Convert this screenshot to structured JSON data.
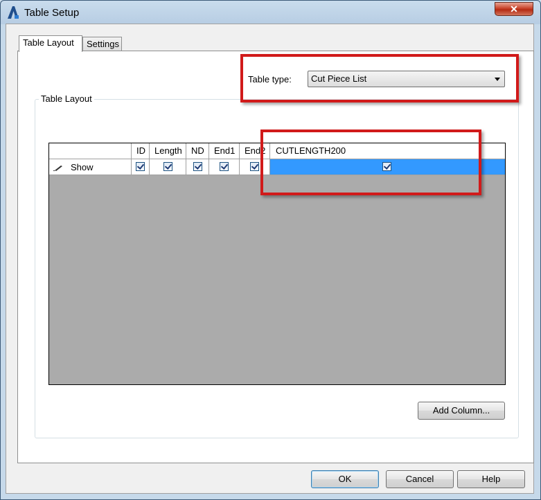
{
  "window": {
    "title": "Table Setup",
    "close_glyph": "✕"
  },
  "tabs": [
    {
      "label": "Table Layout",
      "active": true
    },
    {
      "label": "Settings",
      "active": false
    }
  ],
  "table_type": {
    "label": "Table type:",
    "value": "Cut Piece List"
  },
  "group": {
    "title": "Table Layout"
  },
  "grid": {
    "columns": [
      "ID",
      "Length",
      "ND",
      "End1",
      "End2",
      "CUTLENGTH200"
    ],
    "row": {
      "label": "Show",
      "checked": [
        true,
        true,
        true,
        true,
        true,
        true
      ]
    },
    "selected_fill": "#3399ff",
    "empty_fill": "#ababab"
  },
  "buttons": {
    "add_column": "Add Column...",
    "ok": "OK",
    "cancel": "Cancel",
    "help": "Help"
  },
  "highlight_color": "#d11a1a"
}
